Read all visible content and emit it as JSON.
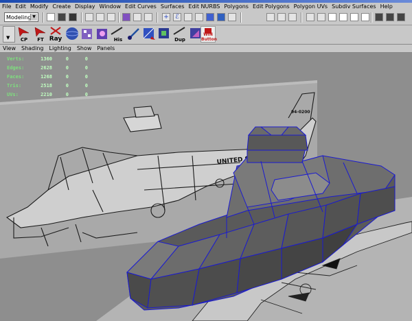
{
  "menubar": {
    "items": [
      "File",
      "Edit",
      "Modify",
      "Create",
      "Display",
      "Window",
      "Edit Curves",
      "Surfaces",
      "Edit NURBS",
      "Polygons",
      "Edit Polygons",
      "Polygon UVs",
      "Subdiv Surfaces",
      "Help"
    ]
  },
  "statusline": {
    "mode": "Modeling"
  },
  "shelf": {
    "buttons": [
      {
        "name": "cp",
        "label": "CP",
        "color": "#c01818"
      },
      {
        "name": "ft",
        "label": "FT",
        "color": "#c01818"
      },
      {
        "name": "ray",
        "label": "Ray",
        "color": "#c01818"
      },
      {
        "name": "his",
        "label": "His",
        "color": "#2050c0"
      },
      {
        "name": "dup",
        "label": "Dup",
        "color": "#2050c0"
      },
      {
        "name": "win-button",
        "label": "WIN Button",
        "color": "#c01818"
      }
    ]
  },
  "panel_menu": {
    "items": [
      "View",
      "Shading",
      "Lighting",
      "Show",
      "Panels"
    ]
  },
  "hud": {
    "rows": [
      {
        "label": "Verts:",
        "v1": "1360",
        "v2": "0",
        "v3": "0"
      },
      {
        "label": "Edges:",
        "v1": "2628",
        "v2": "0",
        "v3": "0"
      },
      {
        "label": "Faces:",
        "v1": "1268",
        "v2": "0",
        "v3": "0"
      },
      {
        "label": "Tris:",
        "v1": "2518",
        "v2": "0",
        "v3": "0"
      },
      {
        "label": "UVs:",
        "v1": "2210",
        "v2": "0",
        "v3": "0"
      }
    ]
  },
  "blueprint": {
    "side_text": "UNITED STATES",
    "tail_text": "94-0200"
  },
  "colors": {
    "ui_bg": "#c8c8c8",
    "viewport_bg": "#8e8e8e",
    "wireframe": "#1a1ad0",
    "hud_text": "#7ee07e"
  }
}
